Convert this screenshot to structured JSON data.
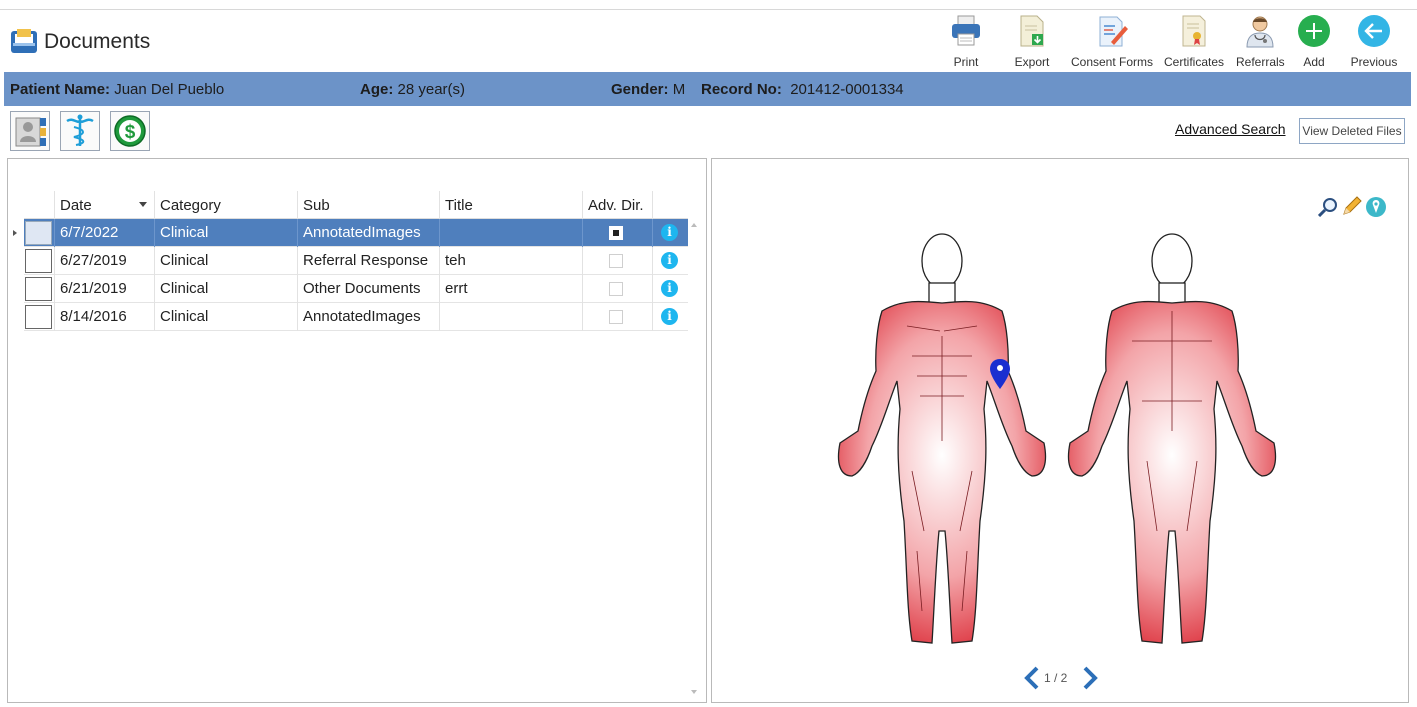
{
  "header": {
    "title": "Documents",
    "toolbar": [
      {
        "name": "print",
        "label": "Print"
      },
      {
        "name": "export",
        "label": "Export"
      },
      {
        "name": "consent-forms",
        "label": "Consent Forms"
      },
      {
        "name": "certificates",
        "label": "Certificates"
      },
      {
        "name": "referrals",
        "label": "Referrals"
      },
      {
        "name": "add",
        "label": "Add"
      },
      {
        "name": "previous",
        "label": "Previous"
      }
    ]
  },
  "patient": {
    "name_label": "Patient Name:",
    "name": "Juan Del Pueblo",
    "age_label": "Age:",
    "age": "28 year(s)",
    "gender_label": "Gender:",
    "gender": "M",
    "record_label": "Record No:",
    "record": "201412-0001334"
  },
  "actions": {
    "advanced_search": "Advanced Search",
    "view_deleted": "View Deleted Files"
  },
  "grid": {
    "columns": [
      "Date",
      "Category",
      "Sub",
      "Title",
      "Adv. Dir."
    ],
    "rows": [
      {
        "date": "6/7/2022",
        "category": "Clinical",
        "sub": "AnnotatedImages",
        "title": "",
        "adv_dir": true,
        "selected": true
      },
      {
        "date": "6/27/2019",
        "category": "Clinical",
        "sub": "Referral Response",
        "title": "teh",
        "adv_dir": false,
        "selected": false
      },
      {
        "date": "6/21/2019",
        "category": "Clinical",
        "sub": "Other Documents",
        "title": "errt",
        "adv_dir": false,
        "selected": false
      },
      {
        "date": "8/14/2016",
        "category": "Clinical",
        "sub": "AnnotatedImages",
        "title": "",
        "adv_dir": false,
        "selected": false
      }
    ]
  },
  "preview": {
    "pager": "1 / 2",
    "image": "anatomy-muscle-diagram",
    "marker": "pin-icon"
  },
  "colors": {
    "patient_bar": "#6c93c8",
    "selected_row": "#4f7fbd",
    "info_icon": "#1eb6ef",
    "add_button": "#27ae4f",
    "previous_button": "#33b5e5",
    "muscle": "#e23a44"
  }
}
